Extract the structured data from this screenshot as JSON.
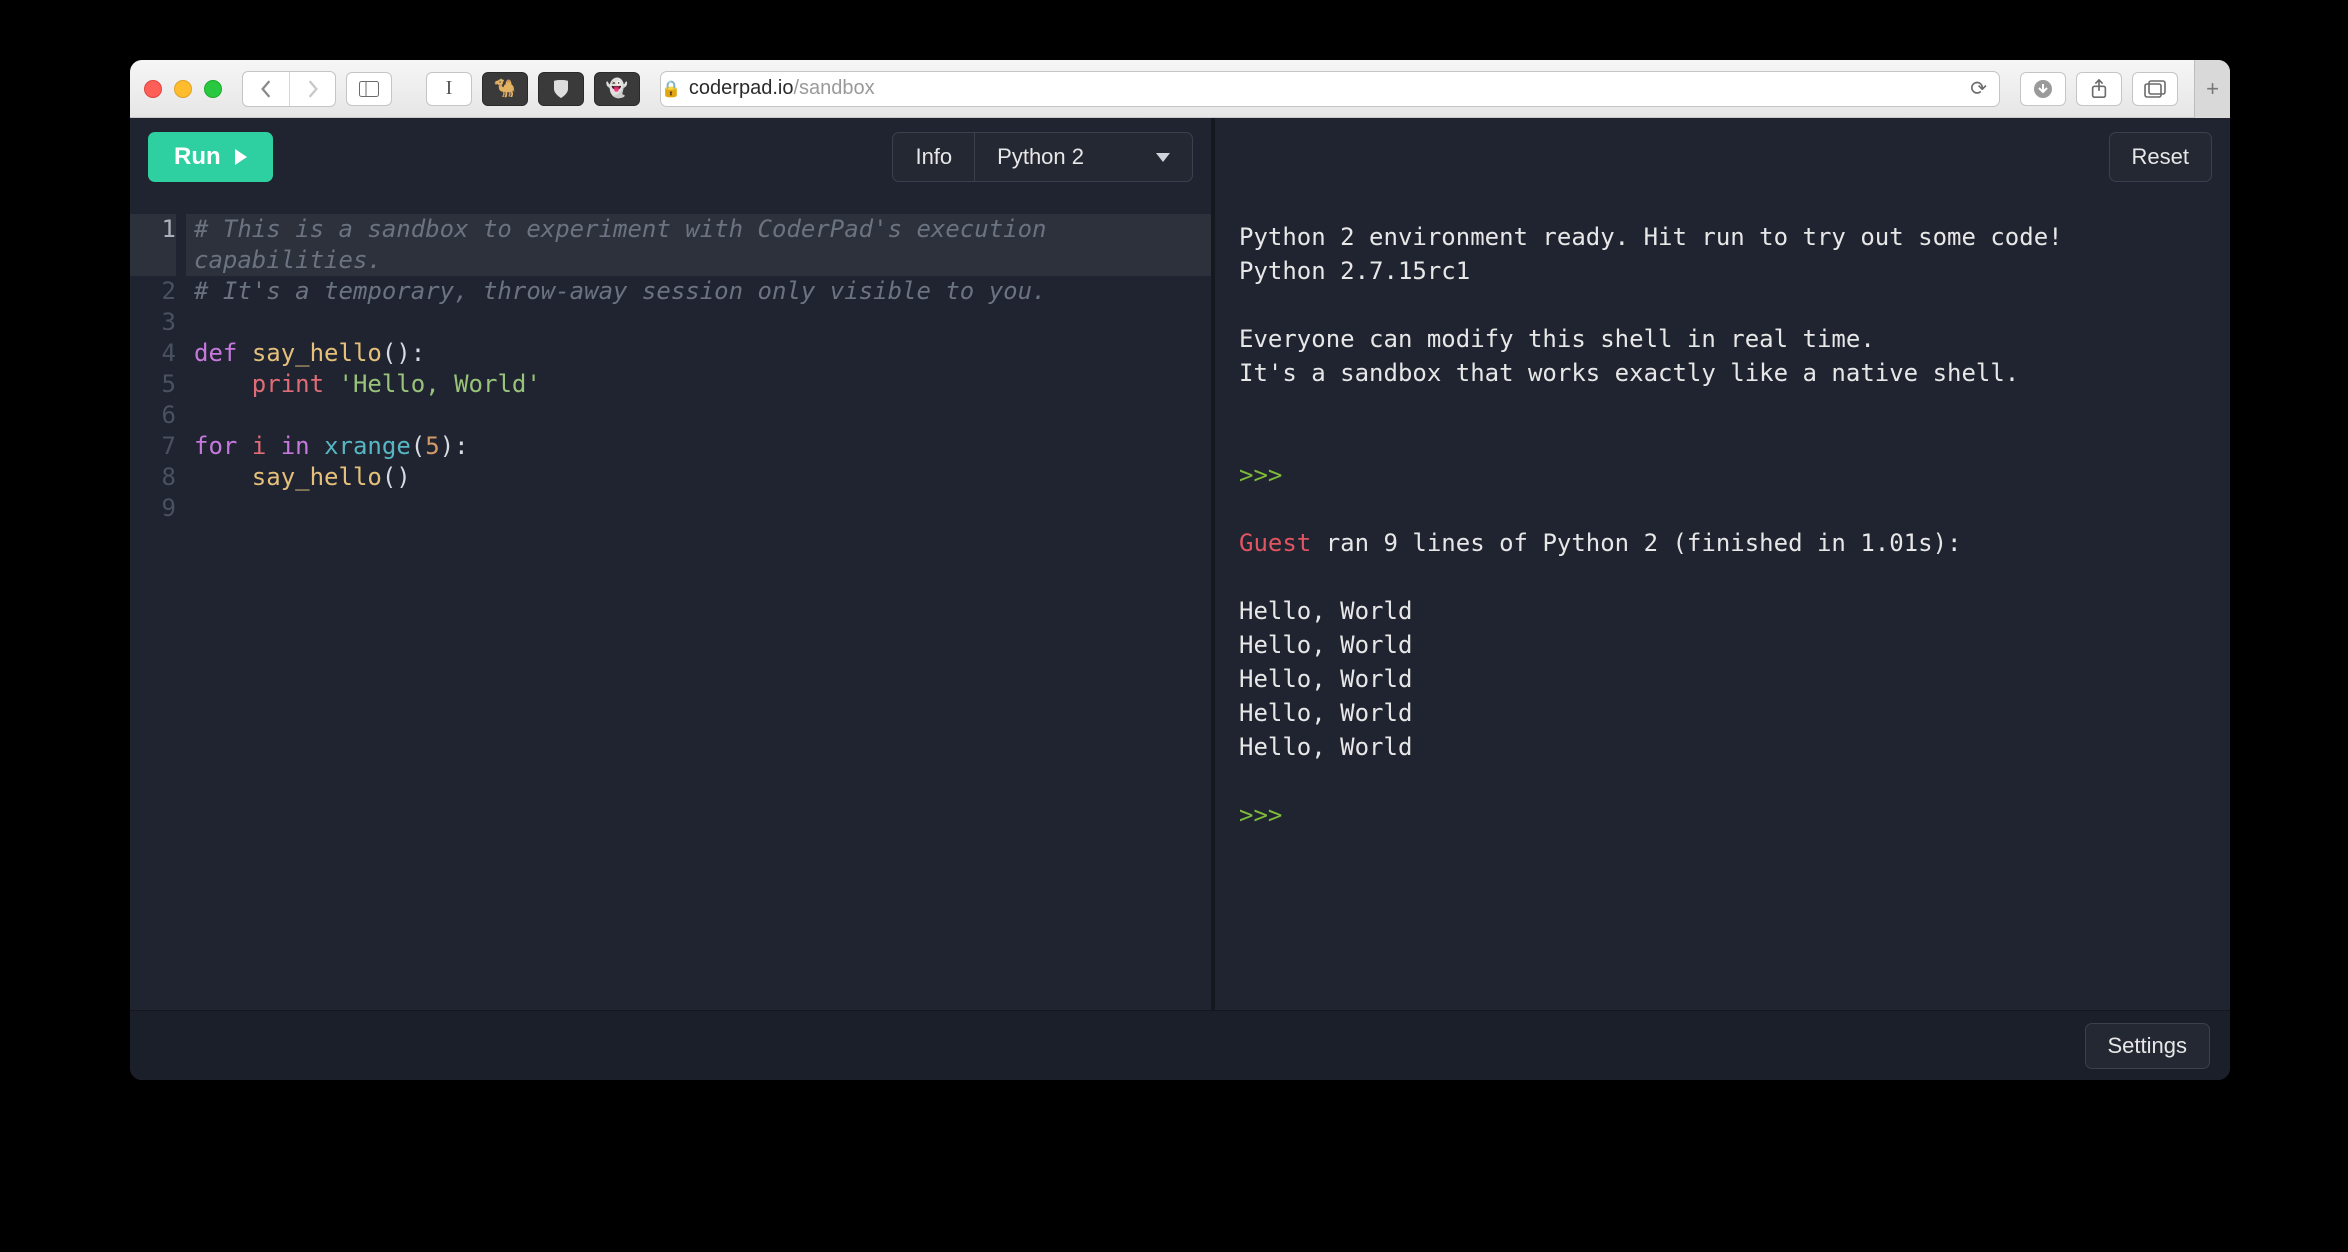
{
  "browser": {
    "url_host": "coderpad.io",
    "url_path": "/sandbox"
  },
  "toolbar": {
    "run_label": "Run",
    "info_label": "Info",
    "language_label": "Python 2",
    "reset_label": "Reset",
    "settings_label": "Settings"
  },
  "editor": {
    "lines": [
      {
        "n": 1,
        "type": "comment",
        "text": "# This is a sandbox to experiment with CoderPad's execution capabilities."
      },
      {
        "n": 2,
        "type": "comment",
        "text": "# It's a temporary, throw-away session only visible to you."
      },
      {
        "n": 3,
        "type": "blank",
        "text": ""
      },
      {
        "n": 4,
        "type": "def",
        "kw": "def",
        "fn": "say_hello",
        "suffix": "():"
      },
      {
        "n": 5,
        "type": "print",
        "indent": "    ",
        "kw": "print",
        "str": "'Hello, World'"
      },
      {
        "n": 6,
        "type": "blank",
        "text": ""
      },
      {
        "n": 7,
        "type": "for",
        "kw1": "for",
        "var": "i",
        "kw2": "in",
        "builtin": "xrange",
        "num": "5",
        "suffix": "):"
      },
      {
        "n": 8,
        "type": "call",
        "indent": "    ",
        "fn": "say_hello",
        "suffix": "()"
      },
      {
        "n": 9,
        "type": "blank",
        "text": ""
      }
    ]
  },
  "console": {
    "banner1": "Python 2 environment ready. Hit run to try out some code!",
    "banner2": "Python 2.7.15rc1",
    "note1": "Everyone can modify this shell in real time.",
    "note2": "It's a sandbox that works exactly like a native shell.",
    "prompt": ">>> ",
    "guest": "Guest",
    "run_msg": " ran 9 lines of Python 2 (finished in 1.01s):",
    "output": [
      "Hello, World",
      "Hello, World",
      "Hello, World",
      "Hello, World",
      "Hello, World"
    ]
  }
}
